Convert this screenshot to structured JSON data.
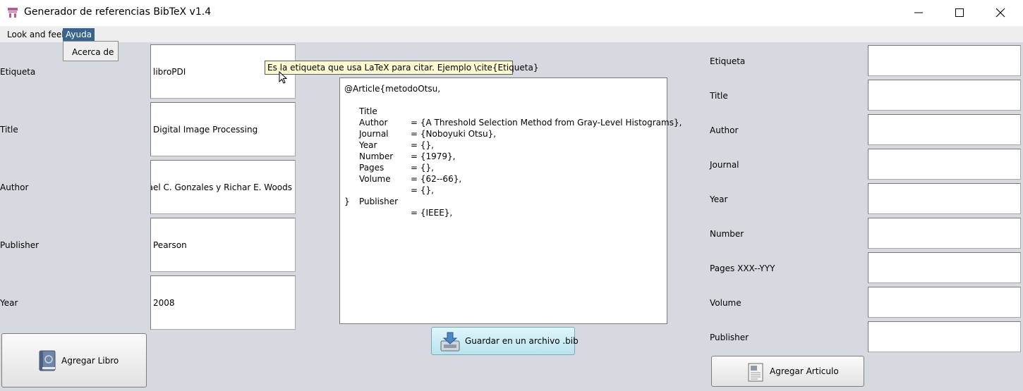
{
  "window": {
    "title": "Generador de referencias BibTeX v1.4",
    "icon": "app-icon",
    "controls": [
      "minimize-icon",
      "maximize-icon",
      "close-icon"
    ]
  },
  "menubar": {
    "items": [
      {
        "label": "Look and feel"
      },
      {
        "label": "Ayuda",
        "active": true
      }
    ],
    "dropdown": {
      "items": [
        "Acerca de"
      ]
    }
  },
  "tooltip": "Es la etiqueta que usa LaTeX para citar. Ejemplo \\cite{Etiqueta}",
  "book_form": {
    "fields": [
      {
        "label": "Etiqueta",
        "value": "libroPDI"
      },
      {
        "label": "Title",
        "value": "Digital Image Processing"
      },
      {
        "label": "Author",
        "value": "Rafael C. Gonzales y Richar E. Woods"
      },
      {
        "label": "Publisher",
        "value": "Pearson"
      },
      {
        "label": "Year",
        "value": "2008"
      }
    ],
    "add_button": "Agregar Libro"
  },
  "preview": {
    "header": "@Article{metodoOtsu,",
    "rows": [
      {
        "key": "Title",
        "value": "= {A Threshold Selection Method from Gray-Level Histograms},"
      },
      {
        "key": "Author",
        "value": "= {Noboyuki Otsu},"
      },
      {
        "key": "Journal",
        "value": "= {},"
      },
      {
        "key": "Year",
        "value": "= {1979},"
      },
      {
        "key": "Number",
        "value": "= {},"
      },
      {
        "key": "Pages",
        "value": "= {62--66},"
      },
      {
        "key": "Volume",
        "value": "= {},"
      },
      {
        "key": "",
        "value": ""
      },
      {
        "key": "Publisher",
        "value": "= {IEEE},"
      }
    ],
    "footer": "}",
    "save_button": "Guardar en un archivo .bib"
  },
  "article_form": {
    "fields": [
      {
        "label": "Etiqueta",
        "value": ""
      },
      {
        "label": "Title",
        "value": ""
      },
      {
        "label": "Author",
        "value": ""
      },
      {
        "label": "Journal",
        "value": ""
      },
      {
        "label": "Year",
        "value": ""
      },
      {
        "label": "Number",
        "value": ""
      },
      {
        "label": "Pages XXX--YYY",
        "value": ""
      },
      {
        "label": "Volume",
        "value": ""
      },
      {
        "label": "Publisher",
        "value": ""
      }
    ],
    "add_button": "Agregar Articulo"
  },
  "colors": {
    "background": "#d6d9df",
    "menu_active": "#38648e",
    "tooltip_bg": "#fffcd2",
    "save_button_bg": "#c9ecf4"
  }
}
